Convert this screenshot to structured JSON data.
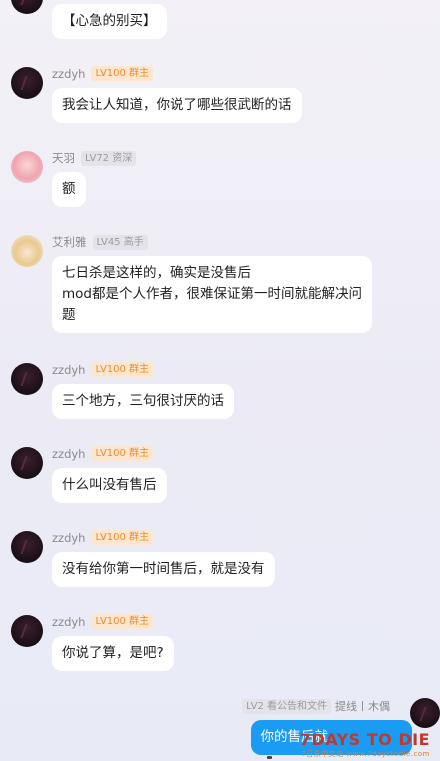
{
  "messages": [
    {
      "avatar": "dark-avatar",
      "name": "",
      "badge": "",
      "text": "【心急的别买】",
      "top_crop": true
    },
    {
      "avatar": "dark-avatar",
      "name": "zzdyh",
      "badge": "LV100 群主",
      "text": "我会让人知道，你说了哪些很武断的话"
    },
    {
      "avatar": "pink-avatar",
      "name": "天羽",
      "badge": "LV72 资深",
      "text": "额"
    },
    {
      "avatar": "blonde-avatar",
      "name": "艾利雅",
      "badge": "LV45 高手",
      "text": "七日杀是这样的，确实是没售后\nmod都是个人作者，很难保证第一时间就能解决问题"
    },
    {
      "avatar": "dark-avatar",
      "name": "zzdyh",
      "badge": "LV100 群主",
      "text": "三个地方，三句很讨厌的话"
    },
    {
      "avatar": "dark-avatar",
      "name": "zzdyh",
      "badge": "LV100 群主",
      "text": "什么叫没有售后"
    },
    {
      "avatar": "dark-avatar",
      "name": "zzdyh",
      "badge": "LV100 群主",
      "text": "没有给你第一时间售后，就是没有"
    },
    {
      "avatar": "dark-avatar",
      "name": "zzdyh",
      "badge": "LV100 群主",
      "text": "你说了算，是吧?"
    }
  ],
  "self_message": {
    "badge": "LV2 看公告和文件",
    "name": "提线丨木偶",
    "text": "你的售后就"
  },
  "watermark": {
    "main": "7DAYS TO DIE",
    "sub": "7日杀中文站 www.7daystodie.com"
  },
  "colors": {
    "owner_badge_bg": "#fde6cf",
    "owner_badge_text": "#f08c2a",
    "self_bubble": "#1a9cf5"
  }
}
